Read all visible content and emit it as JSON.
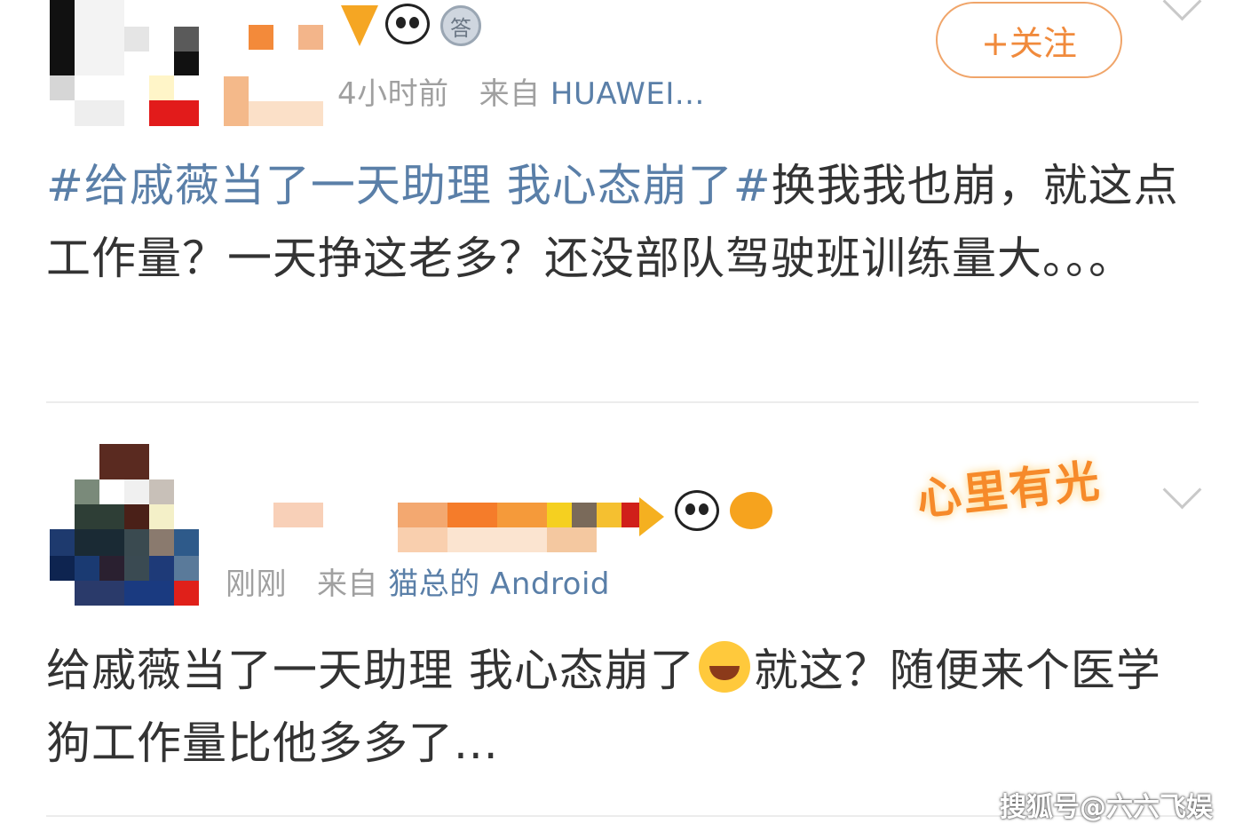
{
  "post1": {
    "time": "4小时前",
    "from_label": "来自",
    "device": "HUAWEI...",
    "follow_label": "+关注",
    "medal_char": "答",
    "topic": "#给戚薇当了一天助理 我心态崩了#",
    "body": "换我我也崩，就这点工作量？一天挣这老多？还没部队驾驶班训练量大。。。"
  },
  "post2": {
    "time": "刚刚",
    "from_label": "来自",
    "device": "猫总的 Android",
    "badge_text": "心里有光",
    "body_before_emoji": "给戚薇当了一天助理 我心态崩了",
    "emoji": "laughing-crying",
    "body_after_emoji": "就这？随便来个医学狗工作量比他多多了..."
  },
  "watermark": "搜狐号@六六飞娱",
  "colors": {
    "topic_link": "#5a7fa8",
    "follow_orange": "#f08a3c",
    "meta_gray": "#a0a0a0",
    "text": "#333333"
  }
}
